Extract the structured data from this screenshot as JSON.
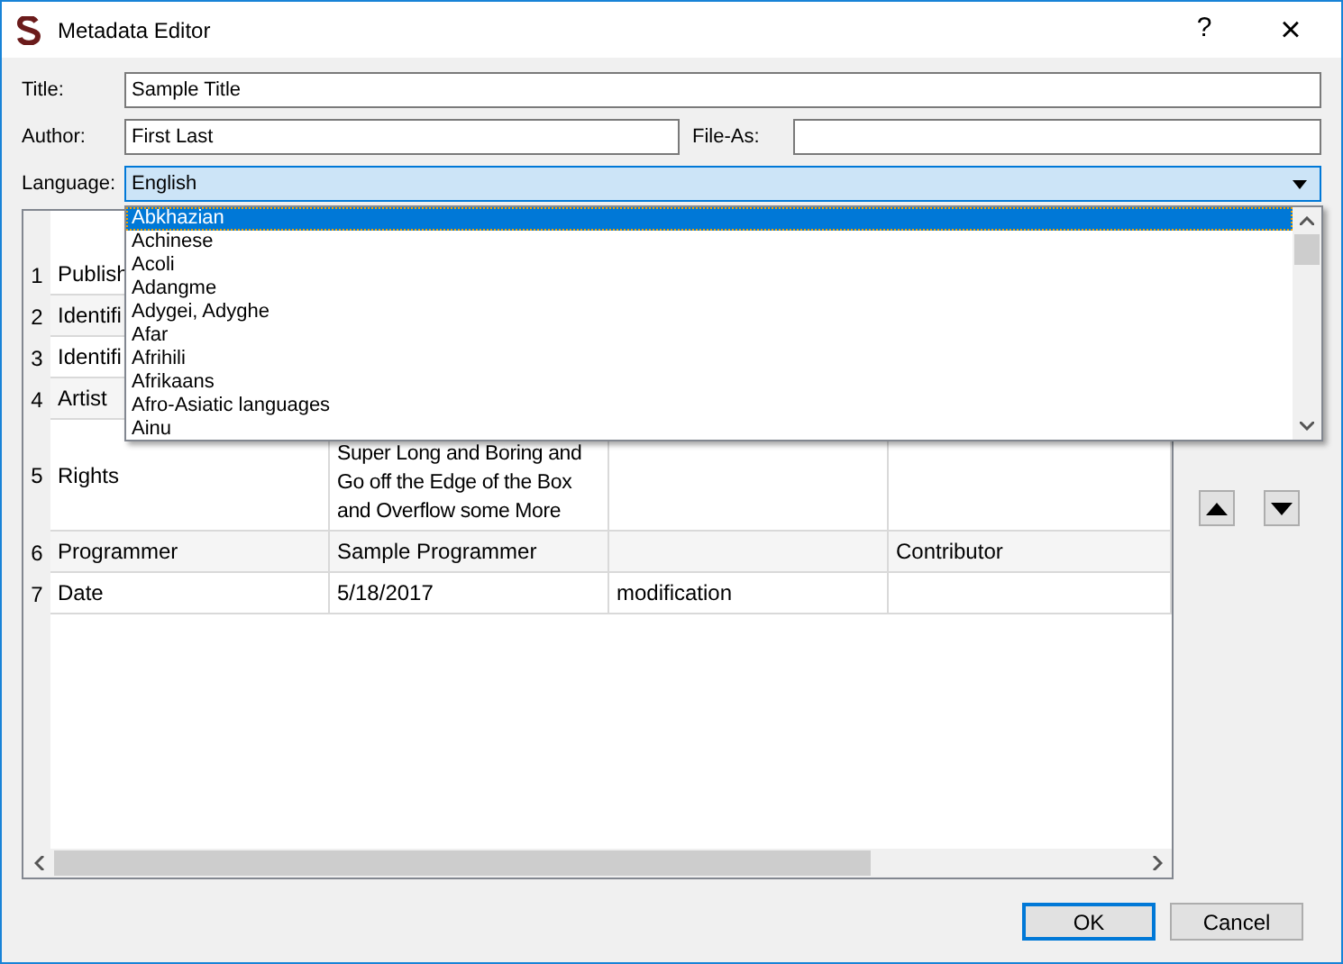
{
  "window": {
    "title": "Metadata Editor",
    "help": "?",
    "close": "×"
  },
  "form": {
    "title_label": "Title:",
    "title_value": "Sample Title",
    "author_label": "Author:",
    "author_value": "First Last",
    "file_as_label": "File-As:",
    "language_label": "Language:",
    "language_value": "English"
  },
  "language_dropdown": {
    "options": [
      {
        "label": "Abkhazian",
        "selected": true
      },
      {
        "label": "Achinese",
        "selected": false
      },
      {
        "label": "Acoli",
        "selected": false
      },
      {
        "label": "Adangme",
        "selected": false
      },
      {
        "label": "Adygei, Adyghe",
        "selected": false
      },
      {
        "label": "Afar",
        "selected": false
      },
      {
        "label": "Afrihili",
        "selected": false
      },
      {
        "label": "Afrikaans",
        "selected": false
      },
      {
        "label": "Afro-Asiatic languages",
        "selected": false
      },
      {
        "label": "Ainu",
        "selected": false
      }
    ]
  },
  "table": {
    "rows": [
      {
        "number": "1",
        "cells": [
          "Publish",
          "",
          "",
          ""
        ]
      },
      {
        "number": "2",
        "cells": [
          "Identifi",
          "",
          "",
          ""
        ]
      },
      {
        "number": "3",
        "cells": [
          "Identifi",
          "",
          "",
          ""
        ]
      },
      {
        "number": "4",
        "cells": [
          "Artist",
          "",
          "",
          ""
        ]
      },
      {
        "number": "5",
        "cells": [
          "Rights",
          "Super Long and Boring and Go off the Edge of the Box and Overflow some More",
          "",
          ""
        ]
      },
      {
        "number": "6",
        "cells": [
          "Programmer",
          "Sample Programmer",
          "",
          "Contributor"
        ]
      },
      {
        "number": "7",
        "cells": [
          "Date",
          "5/18/2017",
          "modification",
          ""
        ]
      }
    ]
  },
  "buttons": [
    "OK",
    "Cancel"
  ]
}
